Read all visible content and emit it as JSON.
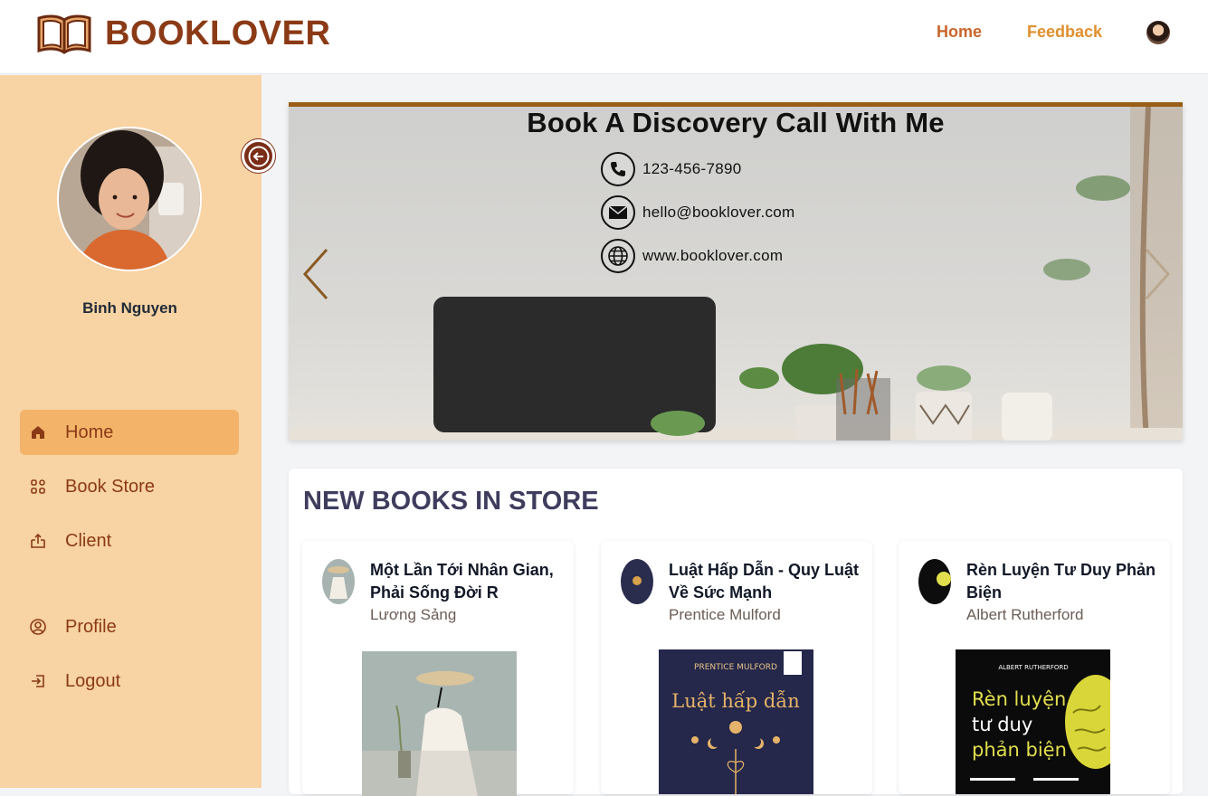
{
  "header": {
    "brand": "BOOKLOVER",
    "nav": [
      {
        "label": "Home"
      },
      {
        "label": "Feedback"
      }
    ]
  },
  "sidebar": {
    "username": "Binh Nguyen",
    "items": [
      {
        "label": "Home",
        "icon": "home-icon",
        "active": true
      },
      {
        "label": "Book Store",
        "icon": "grid-icon"
      },
      {
        "label": "Client",
        "icon": "box-upload-icon"
      },
      {
        "label": "Profile",
        "icon": "user-circle-icon"
      },
      {
        "label": "Logout",
        "icon": "logout-icon"
      }
    ]
  },
  "carousel": {
    "title": "Book A Discovery Call With Me",
    "phone": "123-456-7890",
    "email": "hello@booklover.com",
    "website": "www.booklover.com"
  },
  "new_books": {
    "title": "NEW BOOKS IN STORE",
    "books": [
      {
        "title": "Một Lần Tới Nhân Gian, Phải Sống Đời R",
        "author": "Lương Sảng",
        "cover_author": "Lương Sảng"
      },
      {
        "title": "Luật Hấp Dẫn - Quy Luật Về Sức Mạnh",
        "author": "Prentice Mulford",
        "cover_author": "PRENTICE MULFORD",
        "cover_title": "Luật hấp dẫn"
      },
      {
        "title": "Rèn Luyện Tư Duy Phản Biện",
        "author": "Albert Rutherford",
        "cover_author": "ALBERT RUTHERFORD",
        "cover_title_1": "Rèn luyện",
        "cover_title_2": "tư duy",
        "cover_title_3": "phản biện"
      }
    ]
  },
  "colors": {
    "brand": "#8b3a16",
    "sidebar_bg": "#f8d3a3",
    "active_item": "#f3b46a",
    "nav_link": "#c9652a"
  }
}
